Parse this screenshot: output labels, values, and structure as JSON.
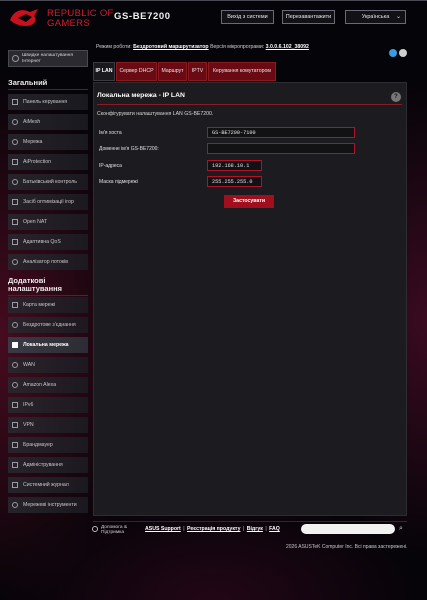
{
  "header": {
    "brand_line1": "REPUBLIC OF",
    "brand_line2": "GAMERS",
    "model": "GS-BE7200",
    "logout_label": "Вихід з системи",
    "reboot_label": "Перезавантажити",
    "language": "Українська"
  },
  "status": {
    "mode_label": "Режим роботи:",
    "mode_value": "Бездротовий маршрутизатор",
    "firmware_label": "Версія мікропрограми:",
    "firmware_value": "3.0.0.6.102_38092"
  },
  "sidebar": {
    "quick_setup": "Швидке налаштування Інтернет",
    "general_title": "Загальний",
    "general_items": [
      {
        "label": "Панель керування",
        "icon": "dashboard-icon"
      },
      {
        "label": "AiMesh",
        "icon": "aimesh-icon"
      },
      {
        "label": "Мережа",
        "icon": "network-icon"
      },
      {
        "label": "AiProtection",
        "icon": "shield-icon"
      },
      {
        "label": "Батьківський контроль",
        "icon": "parental-icon"
      },
      {
        "label": "Засіб оптимізації ігор",
        "icon": "game-boost-icon"
      },
      {
        "label": "Open NAT",
        "icon": "open-nat-icon"
      },
      {
        "label": "Адаптивна QoS",
        "icon": "qos-icon"
      },
      {
        "label": "Аналізатор потоків",
        "icon": "traffic-analyzer-icon"
      }
    ],
    "advanced_title": "Додаткові налаштування",
    "advanced_items": [
      {
        "label": "Карта мережі",
        "icon": "network-map-icon"
      },
      {
        "label": "Бездротове з'єднання",
        "icon": "wireless-icon"
      },
      {
        "label": "Локальна мережа",
        "icon": "lan-icon",
        "active": true
      },
      {
        "label": "WAN",
        "icon": "wan-icon"
      },
      {
        "label": "Amazon Alexa",
        "icon": "alexa-icon"
      },
      {
        "label": "IPv6",
        "icon": "ipv6-icon"
      },
      {
        "label": "VPN",
        "icon": "vpn-icon"
      },
      {
        "label": "Брандмауер",
        "icon": "firewall-icon"
      },
      {
        "label": "Адміністрування",
        "icon": "admin-icon"
      },
      {
        "label": "Системний журнал",
        "icon": "system-log-icon"
      },
      {
        "label": "Мережеві інструменти",
        "icon": "network-tools-icon"
      }
    ]
  },
  "tabs": [
    "IP LAN",
    "Сервер DHCP",
    "Маршрут",
    "IPTV",
    "Керування комутатором"
  ],
  "panel": {
    "title": "Локальна мережа - IP LAN",
    "description": "Сконфігурувати налаштування LAN GS-BE7200.",
    "fields": [
      {
        "label": "Ім'я хоста",
        "value": "GS-BE7200-7100"
      },
      {
        "label": "Доменне ім'я GS-BE7200:",
        "value": ""
      },
      {
        "label": "IP-адреса",
        "value": "192.168.10.1"
      },
      {
        "label": "Маска підмережі",
        "value": "255.255.255.0"
      }
    ],
    "apply_label": "Застосувати"
  },
  "footer": {
    "support_label": "Допомога & Підтримка",
    "links": [
      "ASUS Support",
      "Реєстрація продукту",
      "Відгук",
      "FAQ"
    ],
    "copyright": "2026 ASUSTeK Computer Inc. Всі права застережені."
  },
  "colors": {
    "accent_red": "#a10f1f",
    "tab_red": "#6a0a12",
    "background": "#050408",
    "panel": "#1c1c20"
  }
}
